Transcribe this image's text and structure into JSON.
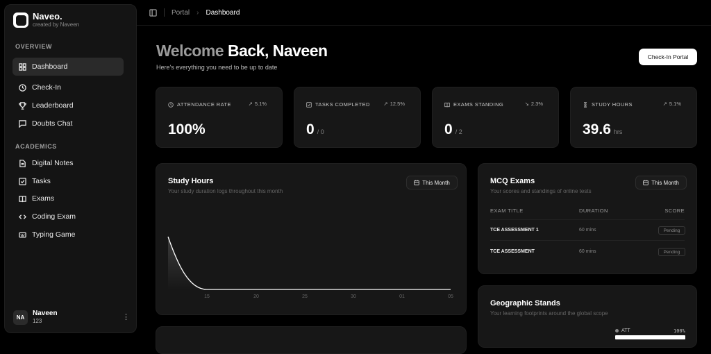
{
  "brand": {
    "name": "Naveo.",
    "subtitle": "created by Naveen"
  },
  "sidebar": {
    "overview_label": "OVERVIEW",
    "academics_label": "ACADEMICS",
    "overview_items": [
      {
        "label": "Dashboard",
        "icon": "grid-icon",
        "active": true
      },
      {
        "label": "Check-In",
        "icon": "clock-icon"
      },
      {
        "label": "Leaderboard",
        "icon": "trophy-icon"
      },
      {
        "label": "Doubts Chat",
        "icon": "chat-icon"
      }
    ],
    "academic_items": [
      {
        "label": "Digital Notes",
        "icon": "file-icon"
      },
      {
        "label": "Tasks",
        "icon": "checkbox-icon"
      },
      {
        "label": "Exams",
        "icon": "book-icon"
      },
      {
        "label": "Coding Exam",
        "icon": "code-icon"
      },
      {
        "label": "Typing Game",
        "icon": "keyboard-icon"
      }
    ],
    "user": {
      "initials": "NA",
      "name": "Naveen",
      "id": "123"
    }
  },
  "topbar": {
    "crumb_root": "Portal",
    "crumb_current": "Dashboard"
  },
  "header": {
    "welcome_prefix": "Welcome",
    "welcome_rest": "Back, Naveen",
    "subtitle": "Here's everything you need to be up to date",
    "checkin_button": "Check-In Portal"
  },
  "stats": [
    {
      "label": "ATTENDANCE RATE",
      "icon": "clock-icon",
      "delta": "5.1%",
      "value": "100%",
      "unit": ""
    },
    {
      "label": "TASKS COMPLETED",
      "icon": "checkbox-icon",
      "delta": "12.5%",
      "value": "0",
      "unit": "/ 0"
    },
    {
      "label": "EXAMS STANDING",
      "icon": "book-icon",
      "delta": "2.3%",
      "value": "0",
      "unit": "/ 2"
    },
    {
      "label": "STUDY HOURS",
      "icon": "timer-icon",
      "delta": "5.1%",
      "value": "39.6",
      "unit": "hrs"
    }
  ],
  "study_hours": {
    "title": "Study Hours",
    "subtitle": "Your study duration logs throughout this month",
    "filter": "This Month"
  },
  "chart_data": {
    "type": "area",
    "x": [
      "",
      "15",
      "20",
      "25",
      "30",
      "01",
      "05"
    ],
    "y": [
      39.6,
      0,
      0,
      0,
      0,
      0,
      0
    ],
    "xticks": [
      "15",
      "20",
      "25",
      "30",
      "01",
      "05"
    ],
    "title": "Study Hours",
    "grid": false
  },
  "mcq": {
    "title": "MCQ Exams",
    "subtitle": "Your scores and standings of online tests",
    "filter": "This Month",
    "columns": [
      "EXAM TITLE",
      "DURATION",
      "SCORE"
    ],
    "rows": [
      {
        "title": "TCE ASSESSMENT 1",
        "duration": "60 mins",
        "score": "Pending"
      },
      {
        "title": "TCE ASSESSMENT",
        "duration": "60 mins",
        "score": "Pending"
      }
    ]
  },
  "geo": {
    "title": "Geographic Stands",
    "subtitle": "Your learning footprints around the global scope",
    "legend_label": "ATT",
    "legend_value": "100%"
  },
  "colors": {
    "background": "#000000",
    "card": "#171717",
    "accent": "#ffffff"
  }
}
